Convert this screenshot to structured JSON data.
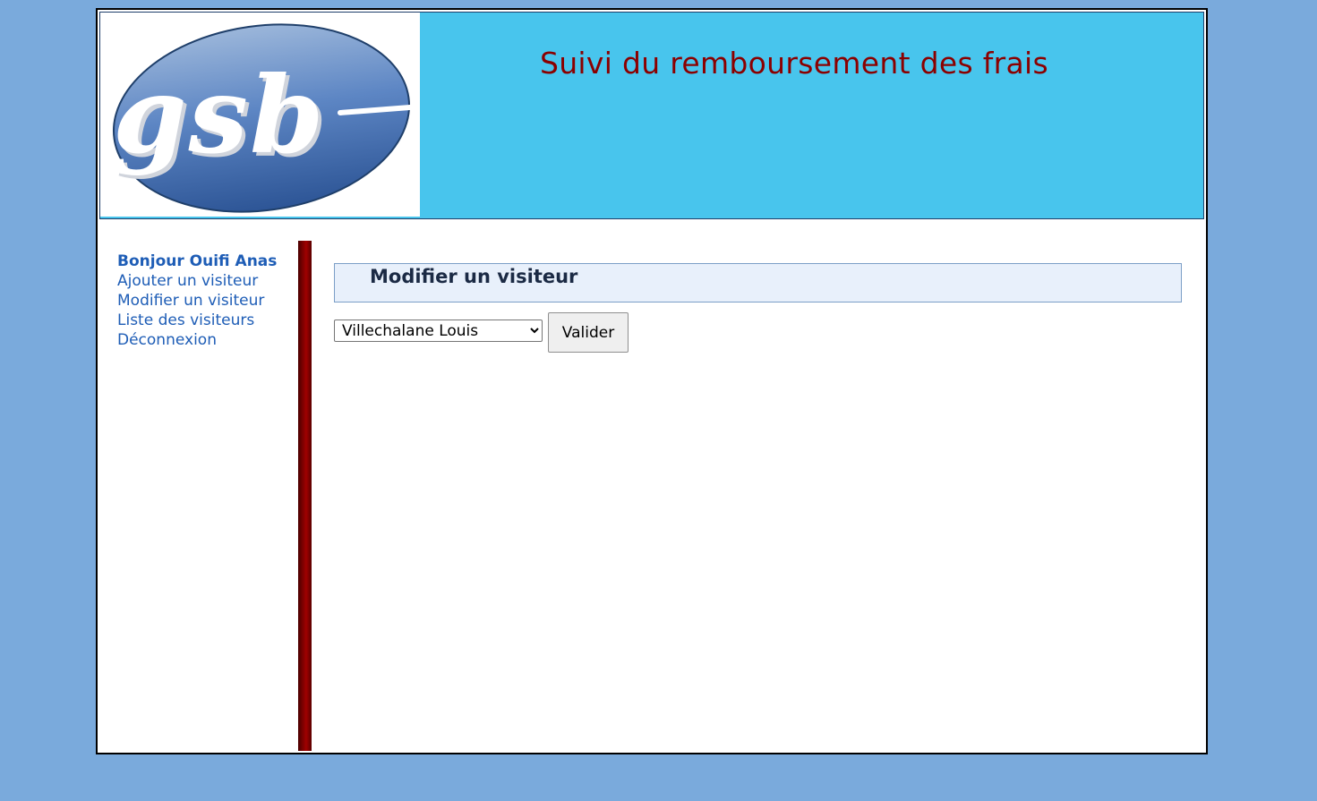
{
  "header": {
    "logo_text": "gsb",
    "title": "Suivi du remboursement des frais"
  },
  "menu": {
    "greeting": "Bonjour Ouifi Anas",
    "items": [
      {
        "label": "Ajouter un visiteur"
      },
      {
        "label": "Modifier un visiteur"
      },
      {
        "label": "Liste des visiteurs"
      },
      {
        "label": "Déconnexion"
      }
    ]
  },
  "content": {
    "title": "Modifier un visiteur",
    "visitor_select": {
      "selected": "Villechalane Louis"
    },
    "submit_label": "Valider"
  },
  "colors": {
    "background": "#7aaadc",
    "header_bg": "#48c5ed",
    "title_color": "#8b0000",
    "menu_link": "#1e5db6",
    "separator": "#8b0000",
    "content_title_bg": "#e8f0fb"
  }
}
